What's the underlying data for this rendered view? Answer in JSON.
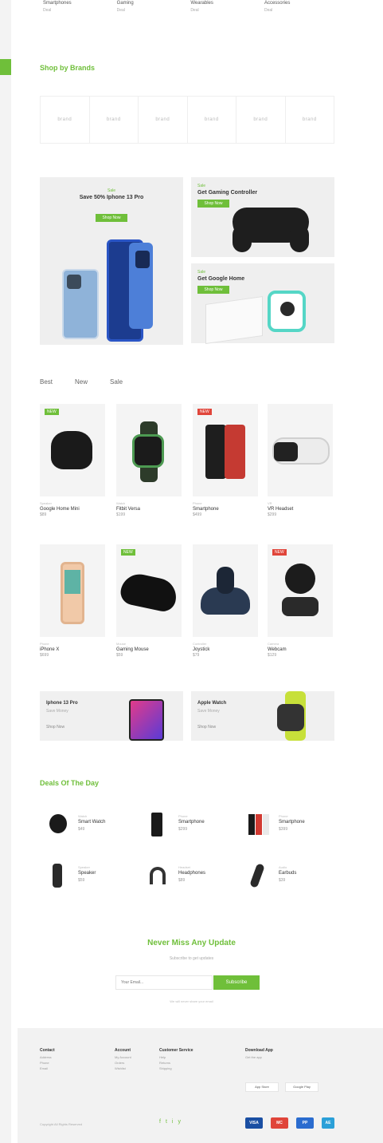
{
  "top_categories": [
    {
      "title": "Smartphones",
      "sub": "Deal"
    },
    {
      "title": "Gaming",
      "sub": "Deal"
    },
    {
      "title": "Wearables",
      "sub": "Deal"
    },
    {
      "title": "Accessories",
      "sub": "Deal"
    }
  ],
  "brands_section": {
    "title": "Shop by Brands",
    "brands": [
      "brand",
      "brand",
      "brand",
      "brand",
      "brand",
      "brand"
    ]
  },
  "promo_main": {
    "subtitle": "Sale",
    "title": "Save 50% Iphone 13 Pro",
    "button": "Shop Now"
  },
  "promo_small": [
    {
      "subtitle": "Sale",
      "title": "Get Gaming Controller",
      "button": "Shop Now"
    },
    {
      "subtitle": "Sale",
      "title": "Get Google Home",
      "button": "Shop Now"
    }
  ],
  "tabs": [
    "Best",
    "New",
    "Sale"
  ],
  "products": [
    {
      "badge": "NEW",
      "badge_color": "#6fbf3a",
      "cat": "Speaker",
      "name": "Google Home Mini",
      "price": "$89"
    },
    {
      "badge": "",
      "badge_color": "",
      "cat": "Watch",
      "name": "Fitbit Versa",
      "price": "$199"
    },
    {
      "badge": "NEW",
      "badge_color": "#e0453a",
      "cat": "Phone",
      "name": "Smartphone",
      "price": "$499"
    },
    {
      "badge": "",
      "badge_color": "",
      "cat": "VR",
      "name": "VR Headset",
      "price": "$299"
    },
    {
      "badge": "",
      "badge_color": "",
      "cat": "Phone",
      "name": "iPhone X",
      "price": "$699"
    },
    {
      "badge": "NEW",
      "badge_color": "#6fbf3a",
      "cat": "Mouse",
      "name": "Gaming Mouse",
      "price": "$59"
    },
    {
      "badge": "",
      "badge_color": "",
      "cat": "Controller",
      "name": "Joystick",
      "price": "$79"
    },
    {
      "badge": "NEW",
      "badge_color": "#e0453a",
      "cat": "Camera",
      "name": "Webcam",
      "price": "$129"
    }
  ],
  "wide_banners": [
    {
      "title": "Iphone 13 Pro",
      "sub": "Save Money",
      "button": "Shop Now"
    },
    {
      "title": "Apple Watch",
      "sub": "Save Money",
      "button": "Shop Now"
    }
  ],
  "deals_section": {
    "title": "Deals Of The Day",
    "deals": [
      {
        "cat": "Watch",
        "name": "Smart Watch",
        "price": "$49"
      },
      {
        "cat": "Phone",
        "name": "Smartphone",
        "price": "$299"
      },
      {
        "cat": "Phone",
        "name": "Smartphone",
        "price": "$399"
      },
      {
        "cat": "Speaker",
        "name": "Speaker",
        "price": "$59"
      },
      {
        "cat": "Headset",
        "name": "Headphones",
        "price": "$89"
      },
      {
        "cat": "Audio",
        "name": "Earbuds",
        "price": "$39"
      }
    ]
  },
  "newsletter": {
    "title": "Never Miss Any Update",
    "subtitle": "Subscribe to get updates",
    "placeholder": "Your Email...",
    "button": "Subscribe",
    "note": "We will never share your email"
  },
  "footer": {
    "columns": [
      {
        "heading": "Contact",
        "links": [
          "Address",
          "Phone",
          "Email"
        ]
      },
      {
        "heading": "Account",
        "links": [
          "My Account",
          "Orders",
          "Wishlist"
        ]
      },
      {
        "heading": "Customer Service",
        "links": [
          "Help",
          "Returns",
          "Shipping"
        ]
      },
      {
        "heading": "Download App",
        "links": [
          "Get the app"
        ]
      }
    ],
    "app_badges": [
      "App Store",
      "Google Play"
    ],
    "copyright": "Copyright All Rights Reserved",
    "socials": [
      "f",
      "t",
      "i",
      "y"
    ],
    "payments": [
      {
        "label": "VISA",
        "color": "#1a4fa3"
      },
      {
        "label": "MC",
        "color": "#e0453a"
      },
      {
        "label": "PP",
        "color": "#2a6ccf"
      },
      {
        "label": "AE",
        "color": "#2ba0d8"
      }
    ]
  }
}
